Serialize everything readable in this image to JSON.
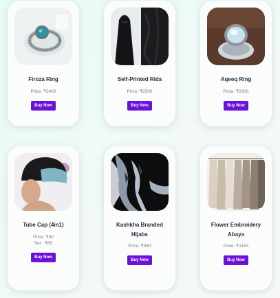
{
  "products": [
    {
      "name": "Firoza Ring",
      "price": "Price: ₹2400",
      "button": "Buy Now",
      "image_icon": "turquoise-ring-image"
    },
    {
      "name": "Self-Printed Rida",
      "price": "Price: ₹2500",
      "button": "Buy Now",
      "image_icon": "rida-image"
    },
    {
      "name": "Aqeeq Ring",
      "price": "Price: ₹2300",
      "button": "Buy Now",
      "image_icon": "aqeeq-ring-image"
    },
    {
      "name": "Tube Cap (4in1)",
      "price": "Price: ₹90",
      "price_set": "Set : ₹65",
      "button": "Buy Now",
      "image_icon": "tube-cap-image"
    },
    {
      "name": "Kashkha Branded Hijabs",
      "price": "Price: ₹350",
      "button": "Buy Now",
      "image_icon": "hijab-image"
    },
    {
      "name": "Flower Embroidery Abaya",
      "price": "Price: ₹1150",
      "button": "Buy Now",
      "image_icon": "abaya-rack-image"
    }
  ],
  "colors": {
    "button": "#6a12d6",
    "card": "#fbfdfc",
    "title": "#2a2a3a",
    "price": "#7a7a7a"
  }
}
